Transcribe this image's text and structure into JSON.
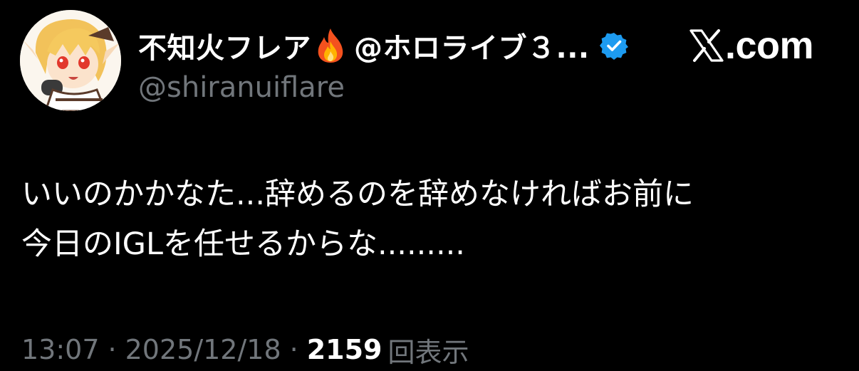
{
  "author": {
    "display_name": "不知火フレア",
    "emoji_icon": "fire-icon",
    "name_suffix": "@ホロライブ３...",
    "verified_icon": "verified-badge-icon",
    "verified_color": "#1d9bf0",
    "handle": "@shiranuiflare"
  },
  "brand": {
    "logo_icon": "x-logo-icon",
    "text": ".com"
  },
  "tweet": {
    "lines": [
      "いいのかかなた...辞めるのを辞めなければお前に",
      "今日のIGLを任せるからな........."
    ]
  },
  "meta": {
    "time": "13:07",
    "separator": "·",
    "date": "2025/12/18",
    "views_count": "2159",
    "views_label": "回表示"
  },
  "colors": {
    "background": "#000000",
    "primary_text": "#ffffff",
    "secondary_text": "#71767b"
  }
}
